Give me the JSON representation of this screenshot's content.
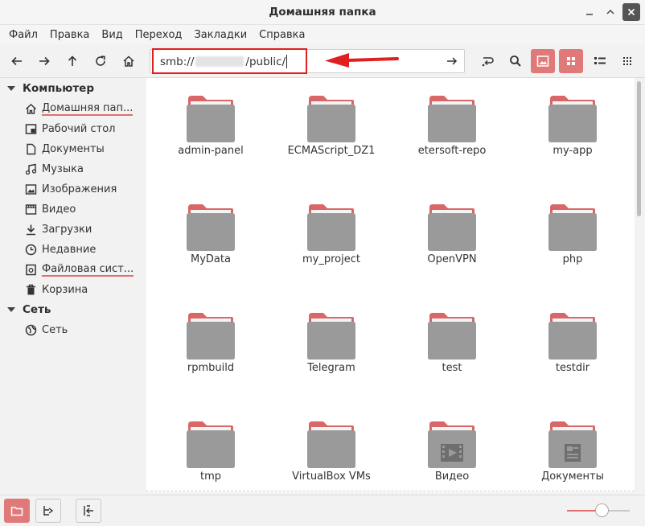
{
  "window": {
    "title": "Домашняя папка"
  },
  "menu": [
    "Файл",
    "Правка",
    "Вид",
    "Переход",
    "Закладки",
    "Справка"
  ],
  "location": {
    "prefix": "smb://",
    "suffix": "/public/"
  },
  "sidebar": {
    "computer_label": "Компьютер",
    "computer_items": [
      {
        "label": "Домашняя пап...",
        "icon": "home-icon"
      },
      {
        "label": "Рабочий стол",
        "icon": "desktop-icon"
      },
      {
        "label": "Документы",
        "icon": "document-icon"
      },
      {
        "label": "Музыка",
        "icon": "music-icon"
      },
      {
        "label": "Изображения",
        "icon": "image-icon"
      },
      {
        "label": "Видео",
        "icon": "video-icon"
      },
      {
        "label": "Загрузки",
        "icon": "download-icon"
      },
      {
        "label": "Недавние",
        "icon": "clock-icon"
      },
      {
        "label": "Файловая сист...",
        "icon": "drive-icon"
      },
      {
        "label": "Корзина",
        "icon": "trash-icon"
      }
    ],
    "network_label": "Сеть",
    "network_items": [
      {
        "label": "Сеть",
        "icon": "network-icon"
      }
    ]
  },
  "files": [
    {
      "name": "admin-panel",
      "type": "folder"
    },
    {
      "name": "ECMAScript_DZ1",
      "type": "folder"
    },
    {
      "name": "etersoft-repo",
      "type": "folder"
    },
    {
      "name": "my-app",
      "type": "folder"
    },
    {
      "name": "MyData",
      "type": "folder"
    },
    {
      "name": "my_project",
      "type": "folder"
    },
    {
      "name": "OpenVPN",
      "type": "folder"
    },
    {
      "name": "php",
      "type": "folder"
    },
    {
      "name": "rpmbuild",
      "type": "folder"
    },
    {
      "name": "Telegram",
      "type": "folder"
    },
    {
      "name": "test",
      "type": "folder"
    },
    {
      "name": "testdir",
      "type": "folder"
    },
    {
      "name": "tmp",
      "type": "folder"
    },
    {
      "name": "VirtualBox VMs",
      "type": "folder"
    },
    {
      "name": "Видео",
      "type": "folder-video"
    },
    {
      "name": "Документы",
      "type": "folder-documents"
    }
  ],
  "zoom_level": 0.55,
  "colors": {
    "accent": "#e07a7a",
    "folder_tab": "#d96767",
    "folder_body": "#9a9a9a",
    "annotation": "#e02020"
  }
}
